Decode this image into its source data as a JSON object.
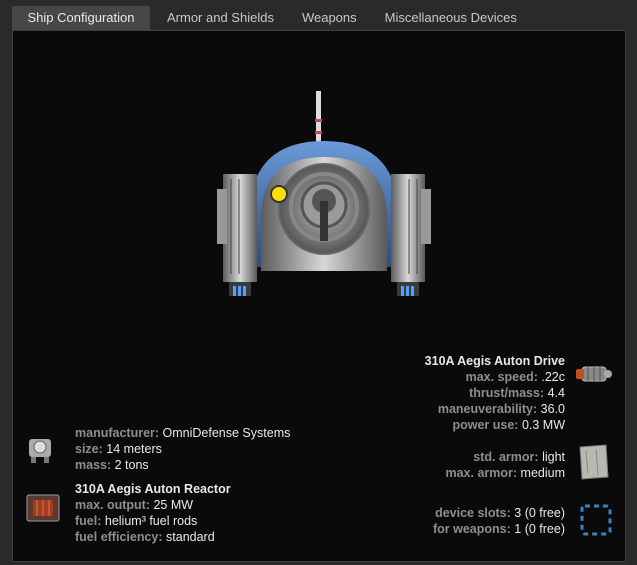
{
  "tabs": [
    {
      "label": "Ship Configuration"
    },
    {
      "label": "Armor and Shields"
    },
    {
      "label": "Weapons"
    },
    {
      "label": "Miscellaneous Devices"
    }
  ],
  "ship_info": {
    "manufacturer_label": "manufacturer:",
    "manufacturer": "OmniDefense Systems",
    "size_label": "size:",
    "size": "14 meters",
    "mass_label": "mass:",
    "mass": "2 tons"
  },
  "reactor": {
    "name": "310A Aegis Auton Reactor",
    "max_output_label": "max. output:",
    "max_output": "25 MW",
    "fuel_label": "fuel:",
    "fuel": "helium³ fuel rods",
    "fuel_eff_label": "fuel efficiency:",
    "fuel_eff": "standard"
  },
  "drive": {
    "name": "310A Aegis Auton Drive",
    "max_speed_label": "max. speed:",
    "max_speed": ".22c",
    "thrust_label": "thrust/mass:",
    "thrust": "4.4",
    "maneuver_label": "maneuverability:",
    "maneuver": "36.0",
    "power_label": "power use:",
    "power": "0.3 MW"
  },
  "armor": {
    "std_label": "std. armor:",
    "std": "light",
    "max_label": "max. armor:",
    "max": "medium"
  },
  "devices": {
    "slots_label": "device slots:",
    "slots": "3 (0 free)",
    "weapons_label": "for weapons:",
    "weapons": "1 (0 free)"
  },
  "colors": {
    "accent": "#3d80c8",
    "panel_bg": "#0a0a0a",
    "label": "#8e8e8e"
  }
}
